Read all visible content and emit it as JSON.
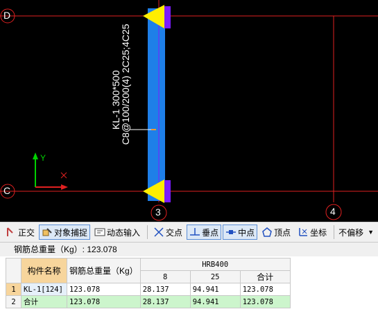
{
  "canvas": {
    "axes": [
      "D",
      "C",
      "3",
      "4"
    ],
    "beam_label_line1": "KL-1 300*500",
    "beam_label_line2": "C8@100/200(4) 2C25;4C25",
    "ucs_y": "Y",
    "colors": {
      "beam": "#1e7fe8",
      "axis_line": "#e02020",
      "support": "#ffee00",
      "support_side": "#7a1cff",
      "background": "#000000"
    }
  },
  "toolbar": {
    "orthogonal": "正交",
    "object_snap": "对象捕捉",
    "dynamic_input": "动态输入",
    "intersection": "交点",
    "perpendicular": "垂点",
    "midpoint": "中点",
    "vertex": "顶点",
    "coordinate": "坐标",
    "offset_select": "不偏移"
  },
  "summary": {
    "text": "钢筋总重量（Kg）: 123.078"
  },
  "table": {
    "header_name": "构件名称",
    "header_weight": "钢筋总重量（Kg）",
    "header_group": "HRB400",
    "sub_headers": [
      "8",
      "25",
      "合计"
    ],
    "rows": [
      {
        "num": "1",
        "name": "KL-1[124]",
        "weight": "123.078",
        "d8": "28.137",
        "d25": "94.941",
        "total": "123.078"
      },
      {
        "num": "2",
        "name": "合计",
        "weight": "123.078",
        "d8": "28.137",
        "d25": "94.941",
        "total": "123.078"
      }
    ]
  }
}
